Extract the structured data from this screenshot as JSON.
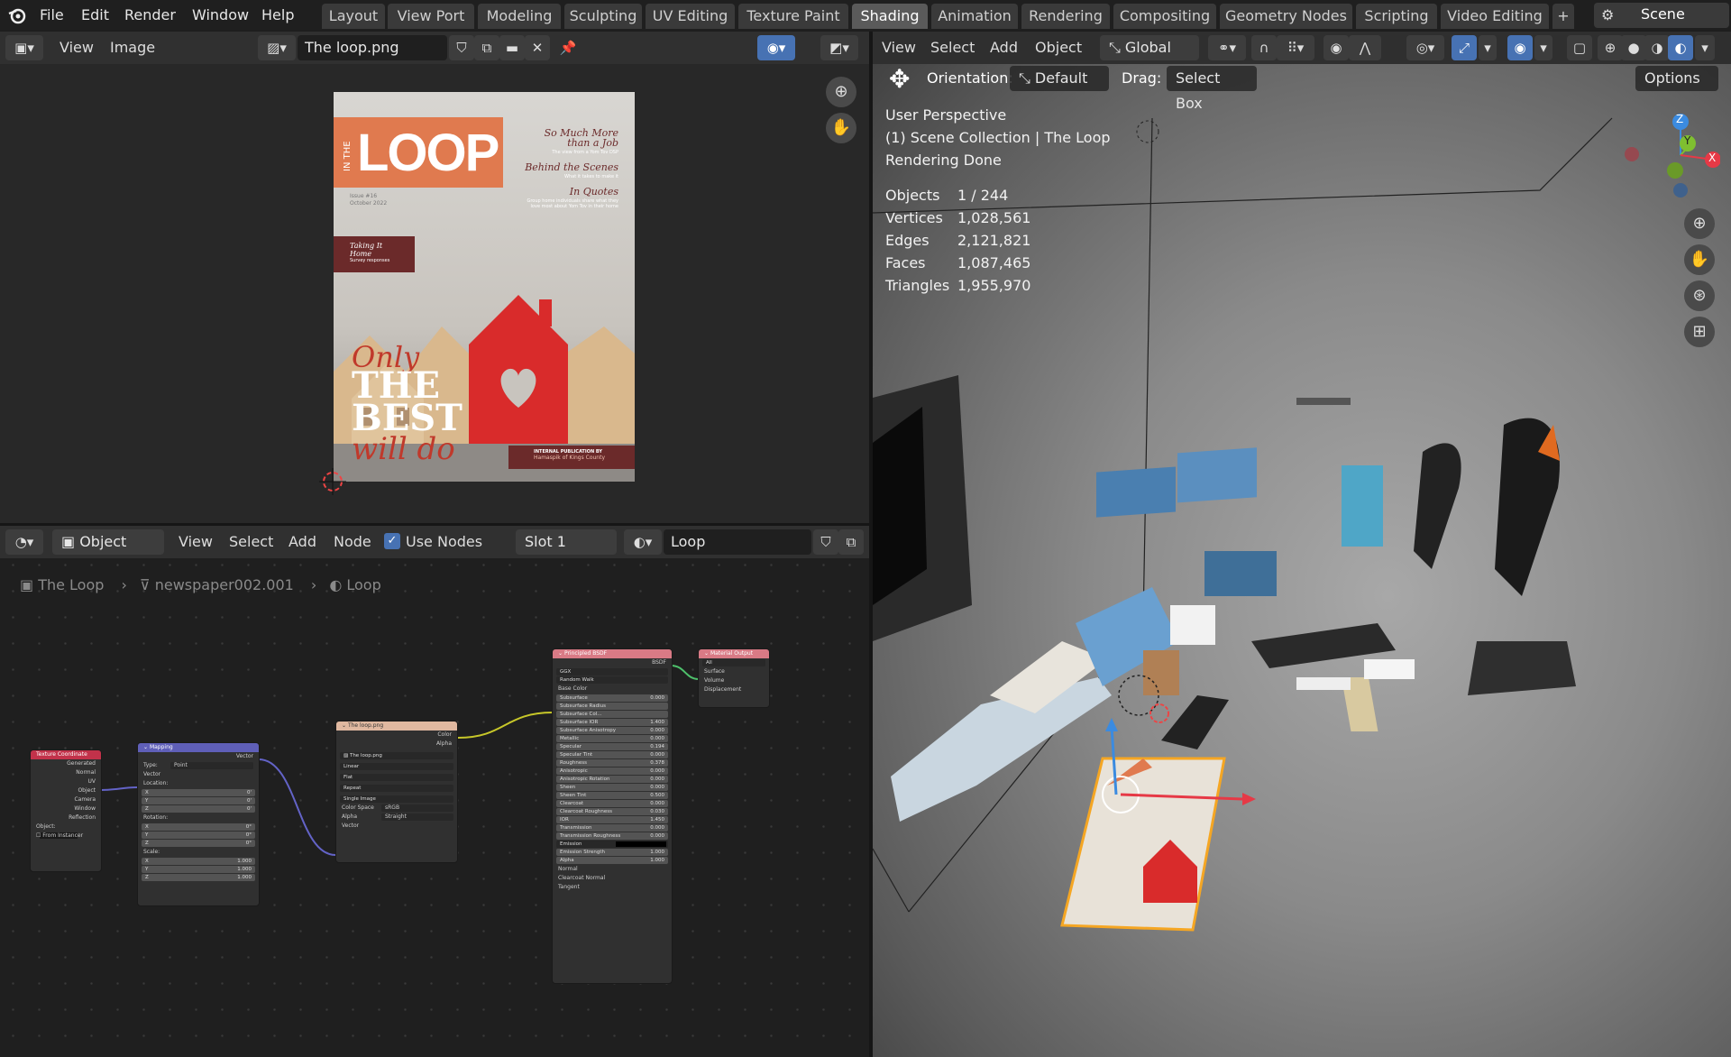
{
  "topbar": {
    "menus": [
      "File",
      "Edit",
      "Render",
      "Window",
      "Help"
    ],
    "workspaces": [
      "Layout",
      "View Port",
      "Modeling",
      "Sculpting",
      "UV Editing",
      "Texture Paint",
      "Shading",
      "Animation",
      "Rendering",
      "Compositing",
      "Geometry Nodes",
      "Scripting",
      "Video Editing"
    ],
    "active_workspace": "Shading",
    "add_tab": "+",
    "scene": "Scene"
  },
  "image_editor": {
    "menus": [
      "View",
      "Image"
    ],
    "image_name": "The loop.png",
    "cover": {
      "brand_side": "IN THE",
      "brand": "LOOP",
      "issue": "Issue #16",
      "date": "October 2022",
      "h1": "So Much More than a Job",
      "s1": "The view from a Yom Tov DSP",
      "h2": "Behind the Scenes",
      "s2": "What it takes to make it",
      "h3": "In Quotes",
      "s3": "Group home individuals share what they love most about Yom Tov in their home",
      "tag1": "Taking It Home",
      "tag2": "Survey responses",
      "only": "Only",
      "the": "THE",
      "best": "BEST",
      "willdo": "will do",
      "pub1": "INTERNAL PUBLICATION BY",
      "pub2": "Hamaspik of Kings County"
    }
  },
  "node_editor": {
    "object_mode": "Object",
    "menus": [
      "View",
      "Select",
      "Add",
      "Node"
    ],
    "use_nodes": "Use Nodes",
    "slot": "Slot 1",
    "material": "Loop",
    "breadcrumb": [
      "The Loop",
      "newspaper002.001",
      "Loop"
    ],
    "tex_coord": {
      "title": "Texture Coordinate",
      "outputs": [
        "Generated",
        "Normal",
        "UV",
        "Object",
        "Camera",
        "Window",
        "Reflection"
      ],
      "object_label": "Object:",
      "from_instancer": "From Instancer"
    },
    "mapping": {
      "title": "Mapping",
      "out": "Vector",
      "type_label": "Type:",
      "type": "Point",
      "vector": "Vector",
      "location": "Location:",
      "rotation": "Rotation:",
      "scale": "Scale:",
      "axes": [
        "X",
        "Y",
        "Z"
      ],
      "loc": [
        "0'",
        "0'",
        "0'"
      ],
      "rot": [
        "0°",
        "0°",
        "0°"
      ],
      "scl": [
        "1.000",
        "1.000",
        "1.000"
      ]
    },
    "image_tex": {
      "title": "The loop.png",
      "outputs": [
        "Color",
        "Alpha"
      ],
      "name": "The loop.png",
      "interp": "Linear",
      "proj": "Flat",
      "ext": "Repeat",
      "src": "Single Image",
      "cs_label": "Color Space",
      "cs": "sRGB",
      "alpha_label": "Alpha",
      "alpha": "Straight",
      "vector": "Vector"
    },
    "bsdf": {
      "title": "Principled BSDF",
      "out": "BSDF",
      "dist": "GGX",
      "sss": "Random Walk",
      "base": "Base Color",
      "rows": [
        [
          "Subsurface",
          "0.000"
        ],
        [
          "Subsurface Radius",
          ""
        ],
        [
          "Subsurface Col...",
          ""
        ],
        [
          "Subsurface IOR",
          "1.400"
        ],
        [
          "Subsurface Anisotropy",
          "0.000"
        ],
        [
          "Metallic",
          "0.000"
        ],
        [
          "Specular",
          "0.194"
        ],
        [
          "Specular Tint",
          "0.000"
        ],
        [
          "Roughness",
          "0.378"
        ],
        [
          "Anisotropic",
          "0.000"
        ],
        [
          "Anisotropic Rotation",
          "0.000"
        ],
        [
          "Sheen",
          "0.000"
        ],
        [
          "Sheen Tint",
          "0.500"
        ],
        [
          "Clearcoat",
          "0.000"
        ],
        [
          "Clearcoat Roughness",
          "0.030"
        ],
        [
          "IOR",
          "1.450"
        ],
        [
          "Transmission",
          "0.000"
        ],
        [
          "Transmission Roughness",
          "0.000"
        ],
        [
          "Emission",
          ""
        ],
        [
          "Emission Strength",
          "1.000"
        ],
        [
          "Alpha",
          "1.000"
        ]
      ],
      "tail": [
        "Normal",
        "Clearcoat Normal",
        "Tangent"
      ]
    },
    "output": {
      "title": "Material Output",
      "target": "All",
      "inputs": [
        "Surface",
        "Volume",
        "Displacement"
      ]
    }
  },
  "viewport": {
    "menus": [
      "View",
      "Select",
      "Add",
      "Object"
    ],
    "transform": "Global",
    "orientation_label": "Orientation:",
    "orientation": "Default",
    "drag_label": "Drag:",
    "drag": "Select Box",
    "options": "Options",
    "info": [
      "User Perspective",
      "(1) Scene Collection | The Loop",
      "Rendering Done"
    ],
    "stats": [
      [
        "Objects",
        "1 / 244"
      ],
      [
        "Vertices",
        "1,028,561"
      ],
      [
        "Edges",
        "2,121,821"
      ],
      [
        "Faces",
        "1,087,465"
      ],
      [
        "Triangles",
        "1,955,970"
      ]
    ],
    "gizmo": {
      "z": "Z",
      "y": "Y",
      "x": "X"
    },
    "colors": {
      "x": "#e63946",
      "y": "#7fbf30",
      "z": "#3b8be0",
      "select": "#f5a623"
    }
  }
}
